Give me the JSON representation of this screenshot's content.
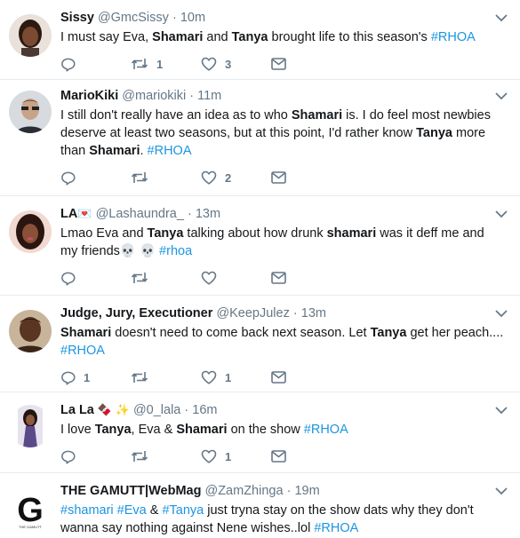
{
  "tweets": [
    {
      "name": "Sissy",
      "name_emoji": "",
      "handle": "@GmcSissy",
      "time": "10m",
      "segments": [
        {
          "t": "I must say Eva, "
        },
        {
          "t": "Shamari",
          "s": "b"
        },
        {
          "t": " and "
        },
        {
          "t": "Tanya",
          "s": "b"
        },
        {
          "t": " brought life to this season's "
        },
        {
          "t": "#RHOA",
          "s": "tag"
        }
      ],
      "replies": "",
      "retweets": "1",
      "likes": "3"
    },
    {
      "name": "MarioKiki",
      "name_emoji": "",
      "handle": "@mariokiki",
      "time": "11m",
      "segments": [
        {
          "t": "I still don't really have an idea as to who "
        },
        {
          "t": "Shamari",
          "s": "b"
        },
        {
          "t": " is. I do feel most newbies deserve at least two seasons, but at this point, I'd rather know "
        },
        {
          "t": "Tanya",
          "s": "b"
        },
        {
          "t": " more than "
        },
        {
          "t": "Shamari",
          "s": "b"
        },
        {
          "t": ". "
        },
        {
          "t": "#RHOA",
          "s": "tag"
        }
      ],
      "replies": "",
      "retweets": "",
      "likes": "2"
    },
    {
      "name": "LA",
      "name_emoji": "💌",
      "handle": "@Lashaundra_",
      "time": "13m",
      "segments": [
        {
          "t": "Lmao Eva and "
        },
        {
          "t": "Tanya",
          "s": "b"
        },
        {
          "t": " talking about how drunk "
        },
        {
          "t": "shamari",
          "s": "b"
        },
        {
          "t": " was it deff me and my friends💀 💀 "
        },
        {
          "t": "#rhoa",
          "s": "tag"
        }
      ],
      "replies": "",
      "retweets": "",
      "likes": ""
    },
    {
      "name": "Judge, Jury, Executioner",
      "name_emoji": "",
      "handle": "@KeepJulez",
      "time": "13m",
      "segments": [
        {
          "t": "Shamari",
          "s": "b"
        },
        {
          "t": " doesn't need to come back next season. Let "
        },
        {
          "t": "Tanya",
          "s": "b"
        },
        {
          "t": " get her peach.... "
        },
        {
          "t": "#RHOA",
          "s": "tag"
        }
      ],
      "replies": "1",
      "retweets": "",
      "likes": "1"
    },
    {
      "name": "La La",
      "name_emoji": "🍫 ✨",
      "handle": "@0_lala",
      "time": "16m",
      "segments": [
        {
          "t": "I love "
        },
        {
          "t": "Tanya",
          "s": "b"
        },
        {
          "t": ", Eva & "
        },
        {
          "t": "Shamari",
          "s": "b"
        },
        {
          "t": " on the show "
        },
        {
          "t": "#RHOA",
          "s": "tag"
        }
      ],
      "replies": "",
      "retweets": "",
      "likes": "1"
    },
    {
      "name": "THE GAMUTT|WebMag",
      "name_emoji": "",
      "handle": "@ZamZhinga",
      "time": "19m",
      "segments": [
        {
          "t": "#shamari",
          "s": "tag"
        },
        {
          "t": " "
        },
        {
          "t": "#Eva",
          "s": "tag"
        },
        {
          "t": " & "
        },
        {
          "t": "#Tanya",
          "s": "tag"
        },
        {
          "t": " just tryna stay on the show dats why they don't wanna say nothing against Nene wishes..lol "
        },
        {
          "t": "#RHOA",
          "s": "tag"
        }
      ],
      "replies": "",
      "retweets": "",
      "likes": ""
    }
  ],
  "separator": "·",
  "avatar_logo": {
    "letter": "G",
    "caption": "THE GAMUTT"
  },
  "colors": {
    "text": "#14171a",
    "secondary": "#657786",
    "link": "#1b95e0",
    "divider": "#e6ecf0"
  },
  "icons": [
    "reply-icon",
    "retweet-icon",
    "like-icon",
    "direct-message-icon",
    "chevron-down-icon"
  ]
}
